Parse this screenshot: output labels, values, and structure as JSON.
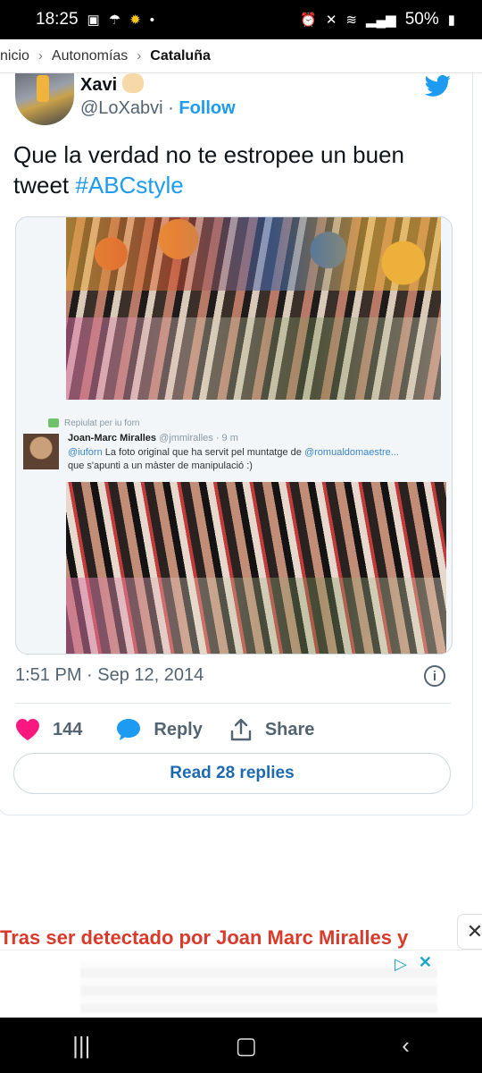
{
  "status_bar": {
    "time": "18:25",
    "battery": "50%"
  },
  "breadcrumb": {
    "items": [
      "nicio",
      "Autonomías",
      "Cataluña"
    ]
  },
  "tweet": {
    "display_name": "Xavi",
    "handle": "@LoXabvi",
    "separator": "·",
    "follow_label": "Follow",
    "text": "Que la verdad no te estropee un buen tweet",
    "hashtag": "#ABCstyle",
    "timestamp": "1:51 PM · Sep 12, 2014",
    "likes": "144",
    "reply_label": "Reply",
    "share_label": "Share",
    "read_replies_label": "Read 28 replies"
  },
  "embedded_tweet": {
    "reposted_by": "Repiulat per iu forn",
    "name": "Joan-Marc Miralles",
    "meta": "@jmmiralles · 9 m",
    "mention1": "@iuforn",
    "text1": "La foto original que ha servit pel muntatge de",
    "mention2": "@romualdomaestre...",
    "text2": "que s'apunti a un màster de manipulació :)"
  },
  "article": {
    "headline": "Tras ser detectado por Joan Marc Miralles y"
  },
  "colors": {
    "twitter_blue": "#1d9bf0",
    "heart": "#f91880",
    "headline_red": "#d93a2b"
  },
  "icons": [
    "twitter-bird-icon",
    "heart-icon",
    "reply-icon",
    "share-icon",
    "info-icon",
    "close-icon",
    "chevron-right-icon"
  ]
}
